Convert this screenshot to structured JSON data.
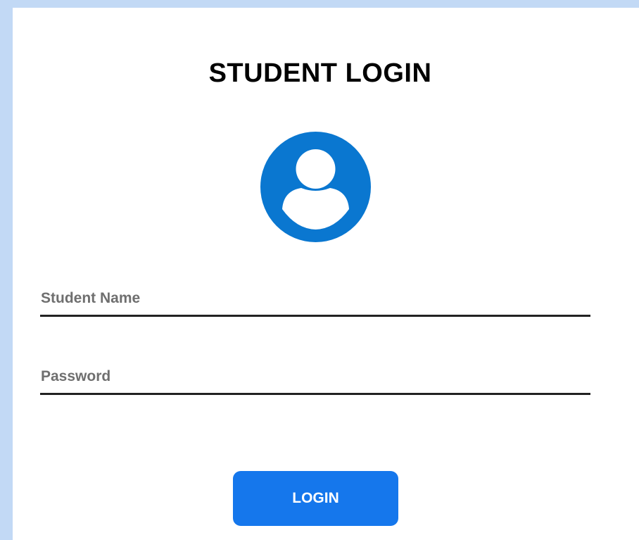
{
  "login_form": {
    "title": "STUDENT LOGIN",
    "avatar_icon": "user-avatar-icon",
    "student_name": {
      "value": "",
      "placeholder": "Student Name"
    },
    "password": {
      "value": "",
      "placeholder": "Password"
    },
    "login_button": "LOGIN"
  },
  "colors": {
    "page_background": "#c2d9f5",
    "card_background": "#ffffff",
    "avatar": "#0a77d0",
    "button": "#1577ec",
    "button_text": "#ffffff",
    "underline": "#222222"
  }
}
